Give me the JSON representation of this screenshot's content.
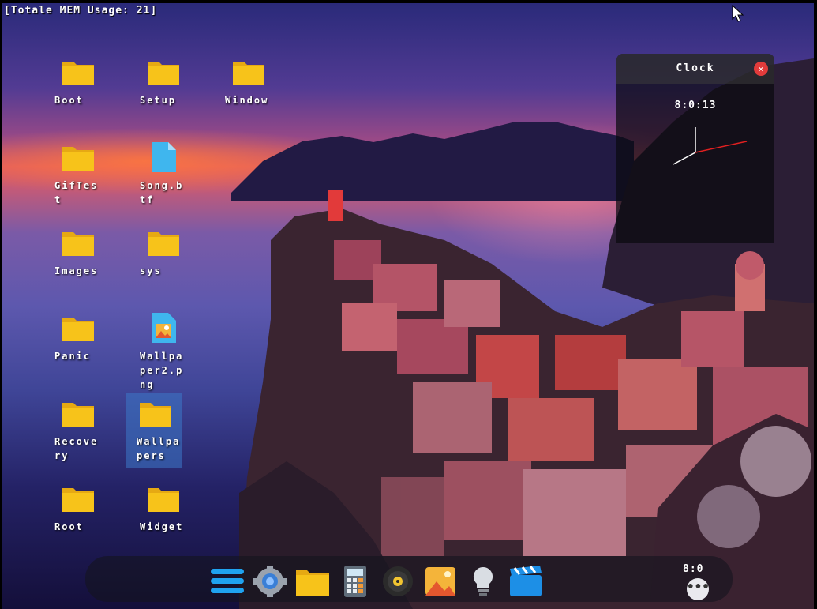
{
  "status": {
    "mem_text": "[Totale MEM Usage: 21]"
  },
  "desktop": {
    "icons": [
      {
        "label": "Boot",
        "type": "folder"
      },
      {
        "label": "Setup",
        "type": "folder"
      },
      {
        "label": "Window",
        "type": "folder"
      },
      {
        "label": "GifTest",
        "type": "folder"
      },
      {
        "label": "Song.btf",
        "type": "file"
      },
      {
        "label": "Images",
        "type": "folder"
      },
      {
        "label": "sys",
        "type": "folder"
      },
      {
        "label": "Panic",
        "type": "folder"
      },
      {
        "label": "Wallpaper2.png",
        "type": "image"
      },
      {
        "label": "Recovery",
        "type": "folder"
      },
      {
        "label": "Wallpapers",
        "type": "folder",
        "selected": true
      },
      {
        "label": "Root",
        "type": "folder"
      },
      {
        "label": "Widget",
        "type": "folder"
      }
    ]
  },
  "clock_widget": {
    "title": "Clock",
    "time": "8:0:13",
    "close_icon": "close-icon"
  },
  "dock": {
    "items": [
      {
        "name": "menu-icon"
      },
      {
        "name": "settings-gear-icon"
      },
      {
        "name": "file-manager-folder-icon"
      },
      {
        "name": "calculator-icon"
      },
      {
        "name": "music-disc-icon"
      },
      {
        "name": "image-viewer-icon"
      },
      {
        "name": "lightbulb-icon"
      },
      {
        "name": "video-clapper-icon"
      }
    ],
    "tray_time": "8:0",
    "more_icon": "more-dots-icon"
  },
  "colors": {
    "folder": "#f7c31a",
    "folder_dark": "#e6a913",
    "file": "#3fb6ee",
    "dock_accent": "#1fa3f0",
    "close": "#e23b3b"
  }
}
